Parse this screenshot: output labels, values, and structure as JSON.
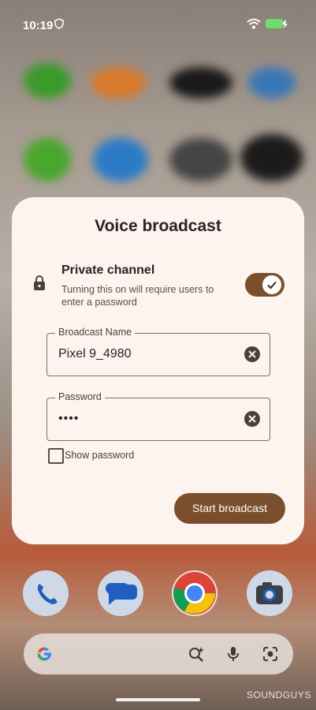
{
  "status_bar": {
    "time": "10:19"
  },
  "dialog": {
    "title": "Voice broadcast",
    "private_channel": {
      "title": "Private channel",
      "description": "Turning this on will require users to enter a password",
      "enabled": true
    },
    "broadcast_name": {
      "label": "Broadcast Name",
      "value": "Pixel 9_4980"
    },
    "password": {
      "label": "Password",
      "value": "••••"
    },
    "show_password": {
      "label": "Show password",
      "checked": false
    },
    "start_button": "Start broadcast"
  },
  "dock": {
    "apps": [
      "phone-icon",
      "messages-icon",
      "chrome-icon",
      "camera-icon"
    ]
  },
  "search_bar": {
    "icons": [
      "google-g-icon",
      "lens-search-icon",
      "microphone-icon",
      "camera-lens-icon"
    ]
  },
  "watermark": "SOUNDGUYS",
  "colors": {
    "accent": "#7b4f2b",
    "sheet_bg": "#fdf3ef"
  }
}
